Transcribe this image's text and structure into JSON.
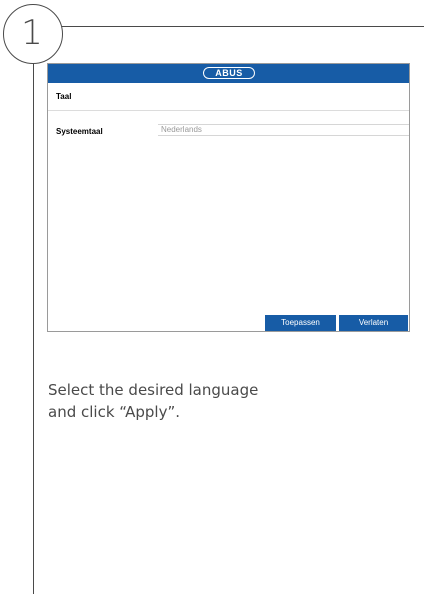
{
  "step": {
    "number": "1"
  },
  "screen": {
    "brand": {
      "logo_text": "ABUS"
    },
    "title": "Taal",
    "fields": [
      {
        "label": "Systeemtaal",
        "value": "Nederlands"
      }
    ],
    "buttons": {
      "apply": "Toepassen",
      "exit": "Verlaten"
    }
  },
  "instruction": {
    "line1": "Select the desired language",
    "line2": "and click “Apply”."
  },
  "colors": {
    "accent": "#175ca6",
    "rule": "#4a4a4a",
    "text": "#4a4a4a"
  }
}
